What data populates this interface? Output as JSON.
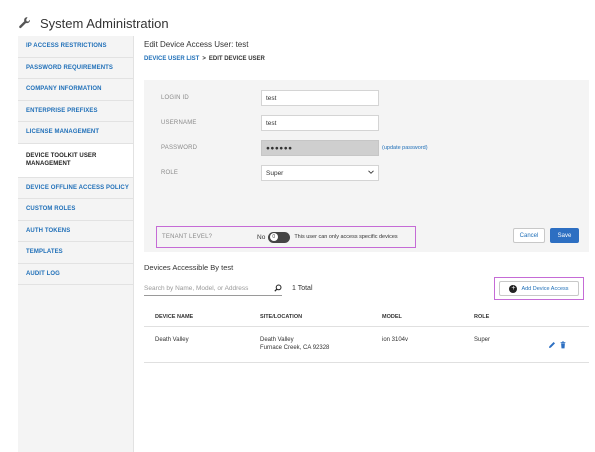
{
  "header": {
    "title": "System Administration",
    "icon": "wrench-icon"
  },
  "sidebar": {
    "items": [
      {
        "label": "IP ACCESS RESTRICTIONS"
      },
      {
        "label": "PASSWORD REQUIREMENTS"
      },
      {
        "label": "COMPANY INFORMATION"
      },
      {
        "label": "ENTERPRISE PREFIXES"
      },
      {
        "label": "LICENSE MANAGEMENT"
      },
      {
        "label": "DEVICE TOOLKIT USER MANAGEMENT"
      },
      {
        "label": "DEVICE OFFLINE ACCESS POLICY"
      },
      {
        "label": "CUSTOM ROLES"
      },
      {
        "label": "AUTH TOKENS"
      },
      {
        "label": "TEMPLATES"
      },
      {
        "label": "AUDIT LOG"
      }
    ]
  },
  "main": {
    "title": "Edit Device Access User: test",
    "breadcrumb": {
      "link": "DEVICE USER LIST",
      "separator": ">",
      "current": "EDIT DEVICE USER"
    }
  },
  "form": {
    "login_id": {
      "label": "LOGIN ID",
      "value": "test"
    },
    "username": {
      "label": "USERNAME",
      "value": "test"
    },
    "password": {
      "label": "PASSWORD",
      "value": "●●●●●●",
      "link": "(update password)"
    },
    "role": {
      "label": "ROLE",
      "value": "Super"
    },
    "tenant_level": {
      "label": "TENANT LEVEL?",
      "toggle_text": "No",
      "toggle_state": "off",
      "hint": "This user can only access specific devices"
    },
    "cancel_label": "Cancel",
    "save_label": "Save"
  },
  "devices": {
    "title": "Devices Accessible By test",
    "search_placeholder": "Search by Name, Model, or Address",
    "total": "1 Total",
    "add_label": "Add Device Access",
    "columns": [
      "DEVICE NAME",
      "SITE/LOCATION",
      "MODEL",
      "ROLE"
    ],
    "rows": [
      {
        "name": "Death Valley",
        "site_line1": "Death Valley",
        "site_line2": "Furnace Creek, CA 92328",
        "model": "ion 3104v",
        "role": "Super"
      }
    ]
  },
  "colors": {
    "accent": "#1f6fb8",
    "save_button": "#2d6fc2",
    "highlight": "#c56bd6",
    "sidebar_bg": "#f4f4f4"
  }
}
